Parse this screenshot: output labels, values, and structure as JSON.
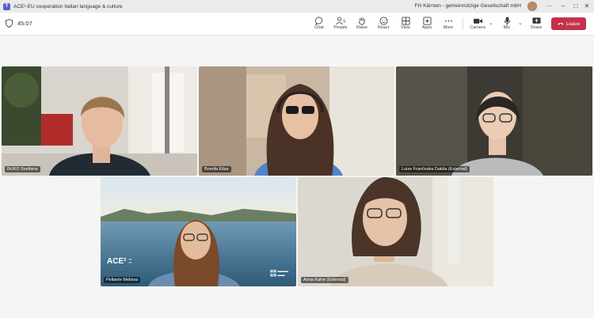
{
  "window": {
    "title": "ACE²-EU cooperation Italian language & culture",
    "org": "FH Kärnten - gemeinnützige Gesellschaft mbH"
  },
  "meeting": {
    "timer": "45:07"
  },
  "toolbar": {
    "chat": "Chat",
    "people": "People",
    "raise": "Raise",
    "react": "React",
    "view": "View",
    "apps": "Apps",
    "more": "More",
    "camera": "Camera",
    "mic": "Mic",
    "share": "Share",
    "leave": "Leave"
  },
  "participants": [
    {
      "name": "BUKO Svetlana"
    },
    {
      "name": "Borella Elisa"
    },
    {
      "name": "Luize Frančeska Dakša (External)"
    },
    {
      "name": "Pellante Melissa"
    },
    {
      "name": "Anna Kalve (External)"
    }
  ],
  "colors": {
    "accent": "#5b5fc7",
    "leave": "#c4314b"
  }
}
